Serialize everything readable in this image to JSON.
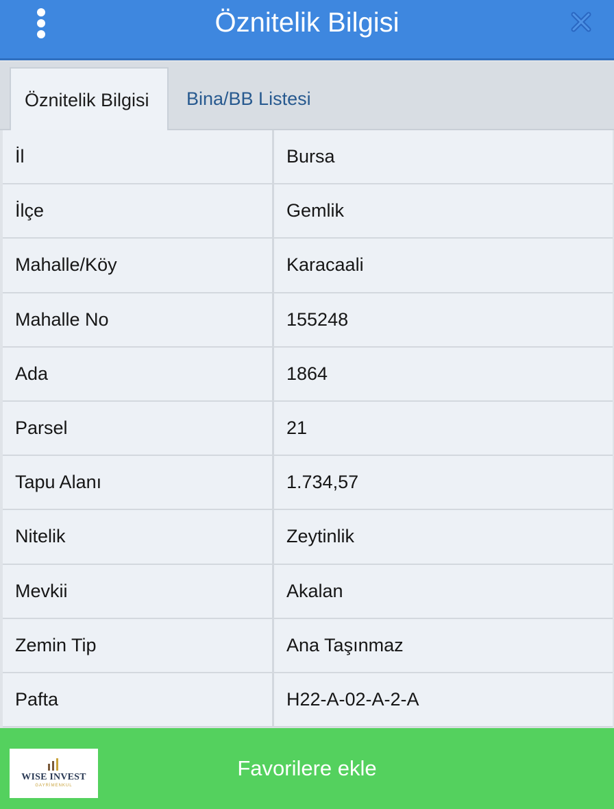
{
  "header": {
    "title": "Öznitelik Bilgisi",
    "menu_icon": "more-vertical-icon",
    "close_icon": "close-icon",
    "background_color": "#3e87df"
  },
  "tabs": [
    {
      "label": "Öznitelik Bilgisi",
      "active": true
    },
    {
      "label": "Bina/BB Listesi",
      "active": false
    }
  ],
  "attributes": [
    {
      "label": "İl",
      "value": "Bursa"
    },
    {
      "label": "İlçe",
      "value": "Gemlik"
    },
    {
      "label": "Mahalle/Köy",
      "value": "Karacaali"
    },
    {
      "label": "Mahalle No",
      "value": "155248"
    },
    {
      "label": "Ada",
      "value": "1864"
    },
    {
      "label": "Parsel",
      "value": "21"
    },
    {
      "label": "Tapu Alanı",
      "value": "1.734,57"
    },
    {
      "label": "Nitelik",
      "value": "Zeytinlik"
    },
    {
      "label": "Mevkii",
      "value": "Akalan"
    },
    {
      "label": "Zemin Tip",
      "value": "Ana Taşınmaz"
    },
    {
      "label": "Pafta",
      "value": "H22-A-02-A-2-A"
    }
  ],
  "footer": {
    "favorite_label": "Favorilere ekle",
    "button_color": "#54d15e",
    "logo_text": "WISE INVEST",
    "logo_subtext": "GAYRİMENKUL"
  }
}
